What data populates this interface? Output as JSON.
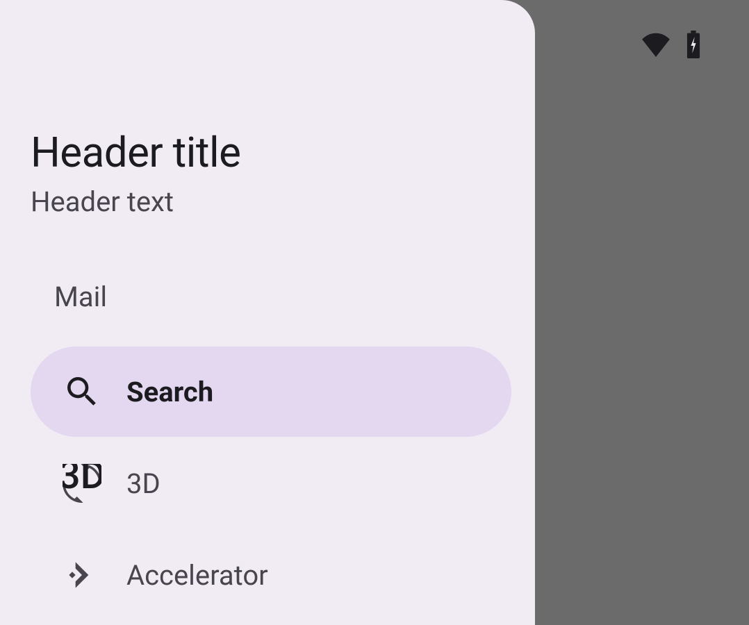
{
  "header": {
    "title": "Header title",
    "subtitle": "Header text"
  },
  "section": {
    "label": "Mail"
  },
  "nav": {
    "items": [
      {
        "label": "Search",
        "icon": "search-icon",
        "selected": true
      },
      {
        "label": "3D",
        "icon": "rotation-3d-icon",
        "selected": false
      },
      {
        "label": "Accelerator",
        "icon": "accelerator-icon",
        "selected": false
      }
    ]
  },
  "status": {
    "wifi": true,
    "battery_charging": true
  }
}
